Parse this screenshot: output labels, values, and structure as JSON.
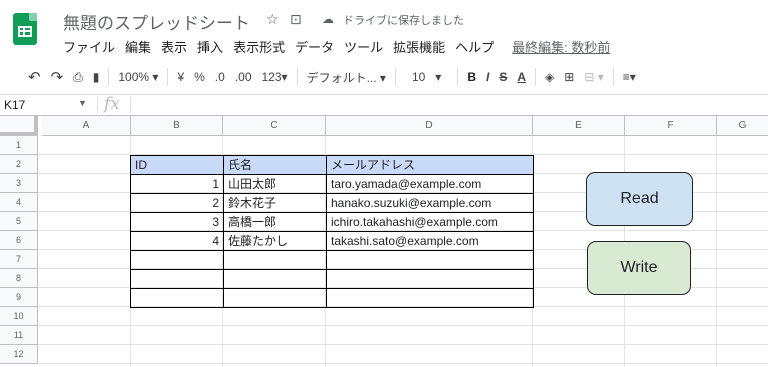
{
  "header": {
    "doc_title": "無題のスプレッドシート",
    "star_icon": "star-icon",
    "move_icon": "folder-move-icon",
    "cloud_icon": "cloud-done-icon",
    "saved_status": "ドライブに保存しました",
    "menu": [
      "ファイル",
      "編集",
      "表示",
      "挿入",
      "表示形式",
      "データ",
      "ツール",
      "拡張機能",
      "ヘルプ"
    ],
    "last_edit": "最終編集: 数秒前"
  },
  "toolbar": {
    "zoom": "100%",
    "currency": "¥",
    "percent": "%",
    "dec_less": ".0",
    "dec_more": ".00",
    "number_format": "123",
    "font": "デフォルト...",
    "font_size": "10",
    "bold": "B",
    "italic": "I",
    "strike": "S",
    "text_color": "A"
  },
  "formula_bar": {
    "name_box": "K17",
    "fx": "fx"
  },
  "columns": [
    "A",
    "B",
    "C",
    "D",
    "E",
    "F",
    "G"
  ],
  "rows": [
    "1",
    "2",
    "3",
    "4",
    "5",
    "6",
    "7",
    "8",
    "9",
    "10",
    "11",
    "12"
  ],
  "table": {
    "headers": [
      "ID",
      "氏名",
      "メールアドレス"
    ],
    "rows": [
      [
        "1",
        "山田太郎",
        "taro.yamada@example.com"
      ],
      [
        "2",
        "鈴木花子",
        "hanako.suzuki@example.com"
      ],
      [
        "3",
        "高橋一郎",
        "ichiro.takahashi@example.com"
      ],
      [
        "4",
        "佐藤たかし",
        "takashi.sato@example.com"
      ],
      [
        "",
        "",
        ""
      ],
      [
        "",
        "",
        ""
      ],
      [
        "",
        "",
        ""
      ]
    ]
  },
  "buttons": {
    "read": "Read",
    "write": "Write"
  },
  "colors": {
    "header_fill": "#c9daf8",
    "read_fill": "#cfe2f3",
    "write_fill": "#d9ead3",
    "brand_green": "#0f9d58"
  }
}
